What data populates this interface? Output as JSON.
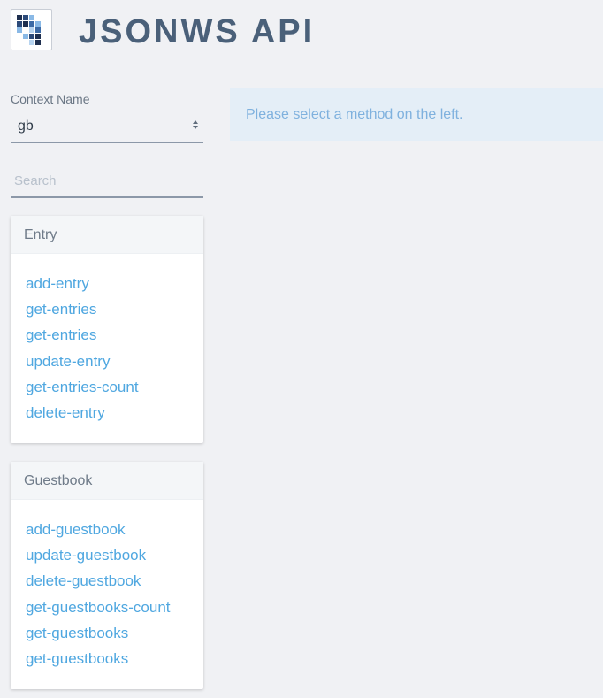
{
  "header": {
    "title": "JSONWS API",
    "logo_icon": "liferay-logo-icon"
  },
  "context": {
    "label": "Context Name",
    "selected": "gb"
  },
  "search": {
    "placeholder": "Search"
  },
  "sections": [
    {
      "title": "Entry",
      "methods": [
        "add-entry",
        "get-entries",
        "get-entries",
        "update-entry",
        "get-entries-count",
        "delete-entry"
      ]
    },
    {
      "title": "Guestbook",
      "methods": [
        "add-guestbook",
        "update-guestbook",
        "delete-guestbook",
        "get-guestbooks-count",
        "get-guestbooks",
        "get-guestbooks"
      ]
    }
  ],
  "main": {
    "message": "Please select a method on the left."
  },
  "colors": {
    "link": "#4fa7e0",
    "title": "#4a6079",
    "message_bg": "#e4eef7",
    "message_text": "#7fb1de"
  }
}
